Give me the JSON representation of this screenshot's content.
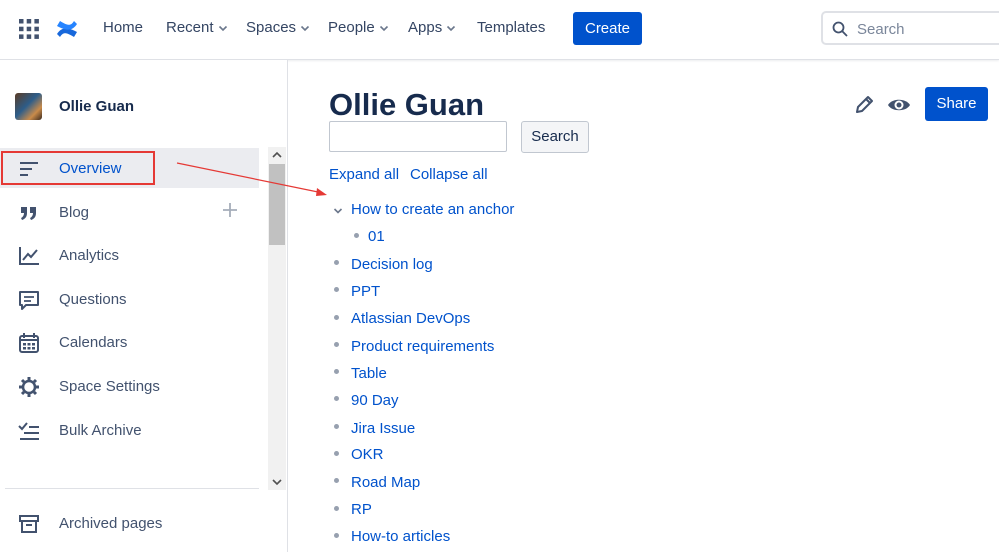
{
  "topbar": {
    "nav": [
      "Home",
      "Recent",
      "Spaces",
      "People",
      "Apps",
      "Templates"
    ],
    "create_label": "Create",
    "search_placeholder": "Search"
  },
  "sidebar": {
    "space_name": "Ollie Guan",
    "items": [
      {
        "label": "Overview",
        "icon": "overview-icon"
      },
      {
        "label": "Blog",
        "icon": "quote-icon"
      },
      {
        "label": "Analytics",
        "icon": "analytics-icon"
      },
      {
        "label": "Questions",
        "icon": "questions-icon"
      },
      {
        "label": "Calendars",
        "icon": "calendar-icon"
      },
      {
        "label": "Space Settings",
        "icon": "gear-icon"
      },
      {
        "label": "Bulk Archive",
        "icon": "checklist-icon"
      }
    ],
    "archived_label": "Archived pages"
  },
  "main": {
    "title": "Ollie Guan",
    "share_label": "Share",
    "search_button": "Search",
    "expand_all": "Expand all",
    "collapse_all": "Collapse all",
    "tree": {
      "parent": "How to create an anchor",
      "child": "01",
      "pages": [
        "Decision log",
        "PPT",
        "Atlassian DevOps",
        "Product requirements",
        "Table",
        "90 Day",
        "Jira Issue",
        "OKR",
        "Road Map",
        "RP",
        "How-to articles"
      ]
    }
  },
  "colors": {
    "accent": "#0052cc",
    "annotation": "#e53935"
  }
}
